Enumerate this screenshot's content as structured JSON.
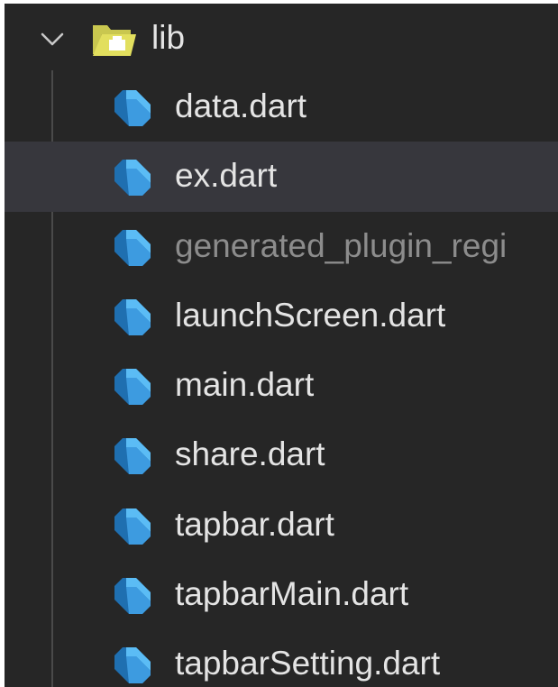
{
  "explorer": {
    "folder": {
      "name": "lib",
      "expanded": true,
      "chevron_icon": "chevron-down-icon",
      "folder_icon": "open-folder-icon",
      "folder_color": "#c9c74f"
    },
    "files": [
      {
        "name": "data.dart",
        "icon": "dart-icon",
        "selected": false,
        "dimmed": false
      },
      {
        "name": "ex.dart",
        "icon": "dart-icon",
        "selected": true,
        "dimmed": false
      },
      {
        "name": "generated_plugin_regi",
        "icon": "dart-icon",
        "selected": false,
        "dimmed": true
      },
      {
        "name": "launchScreen.dart",
        "icon": "dart-icon",
        "selected": false,
        "dimmed": false
      },
      {
        "name": "main.dart",
        "icon": "dart-icon",
        "selected": false,
        "dimmed": false
      },
      {
        "name": "share.dart",
        "icon": "dart-icon",
        "selected": false,
        "dimmed": false
      },
      {
        "name": "tapbar.dart",
        "icon": "dart-icon",
        "selected": false,
        "dimmed": false
      },
      {
        "name": "tapbarMain.dart",
        "icon": "dart-icon",
        "selected": false,
        "dimmed": false
      },
      {
        "name": "tapbarSetting.dart",
        "icon": "dart-icon",
        "selected": false,
        "dimmed": false
      }
    ],
    "colors": {
      "background": "#262626",
      "selected_row": "#37373d",
      "text": "#e4e4e4",
      "dimmed_text": "#8c8c8c",
      "dart_dark": "#1f6fb0",
      "dart_light": "#5bbcf5"
    }
  }
}
